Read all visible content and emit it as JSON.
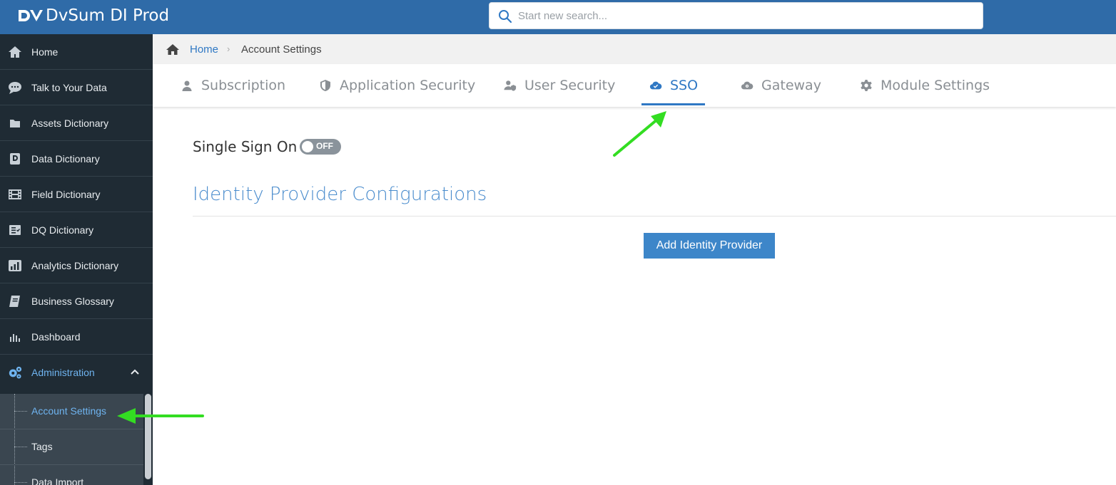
{
  "app": {
    "title": "DvSum DI Prod",
    "brand_color": "#2f6ba8",
    "accent_color": "#2f78c4"
  },
  "search": {
    "placeholder": "Start new search...",
    "value": ""
  },
  "sidebar": {
    "items": [
      {
        "label": "Home",
        "icon": "home-icon"
      },
      {
        "label": "Talk to Your Data",
        "icon": "chat-icon"
      },
      {
        "label": "Assets Dictionary",
        "icon": "folder-icon"
      },
      {
        "label": "Data Dictionary",
        "icon": "book-d-icon"
      },
      {
        "label": "Field Dictionary",
        "icon": "film-icon"
      },
      {
        "label": "DQ Dictionary",
        "icon": "checklist-icon"
      },
      {
        "label": "Analytics Dictionary",
        "icon": "bar-chart-icon"
      },
      {
        "label": "Business Glossary",
        "icon": "glossary-icon"
      },
      {
        "label": "Dashboard",
        "icon": "dashboard-icon"
      },
      {
        "label": "Administration",
        "icon": "gears-icon"
      }
    ],
    "sub_items": [
      {
        "label": "Account Settings",
        "active": true
      },
      {
        "label": "Tags"
      },
      {
        "label": "Data Import"
      }
    ]
  },
  "breadcrumb": {
    "home": "Home",
    "current": "Account Settings"
  },
  "tabs": [
    {
      "label": "Subscription",
      "icon": "user-icon"
    },
    {
      "label": "Application Security",
      "icon": "shield-icon"
    },
    {
      "label": "User Security",
      "icon": "user-shield-icon"
    },
    {
      "label": "SSO",
      "icon": "cloud-icon",
      "active": true
    },
    {
      "label": "Gateway",
      "icon": "cloud-gear-icon"
    },
    {
      "label": "Module Settings",
      "icon": "gear-icon"
    }
  ],
  "content": {
    "sso_label": "Single Sign On",
    "toggle_state": "OFF",
    "section_title": "Identity Provider Configurations",
    "add_button": "Add Identity Provider"
  }
}
